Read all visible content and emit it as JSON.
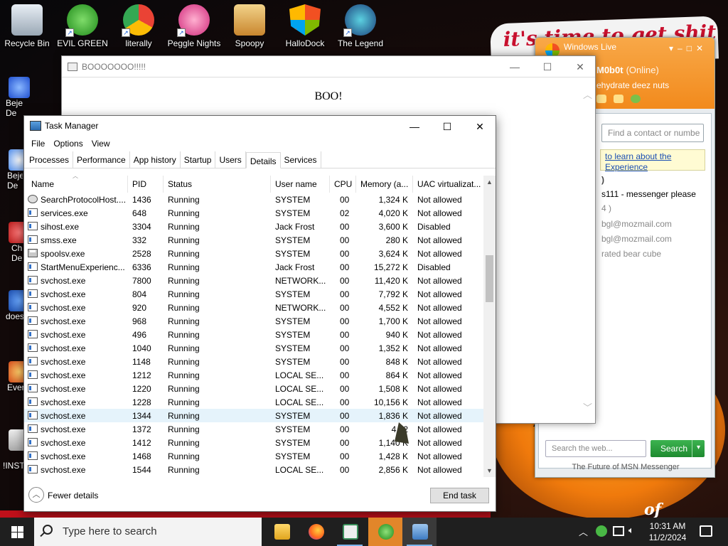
{
  "desktop": {
    "icons": [
      {
        "label": "Recycle Bin"
      },
      {
        "label": "EVIL GREEN MSN GO..."
      },
      {
        "label": "literally"
      },
      {
        "label": "Peggle Nights Del..."
      },
      {
        "label": "Spoopy"
      },
      {
        "label": "HalloDock"
      },
      {
        "label": "The Legend of Tide..."
      }
    ],
    "side_labels": [
      "Beje De",
      "Beje De",
      "Ch De",
      "does",
      "Ever",
      "!INST"
    ],
    "banner_text": "it's time to get shit",
    "wallpaper_text": "of"
  },
  "msn": {
    "title": "Windows Live",
    "user_name": "M0b0t",
    "status": "(Online)",
    "personal_message": "ehydrate deez nuts",
    "find_placeholder": "Find a contact or numbe",
    "ad_line1": "to learn about the",
    "ad_line2": "Experience",
    "contacts": [
      ")",
      "s111 - messenger please",
      "4 )",
      "bgl@mozmail.com",
      "bgl@mozmail.com",
      "rated bear cube"
    ],
    "search_placeholder": "Search the web...",
    "search_button": "Search",
    "footer": "The Future of MSN Messenger"
  },
  "boo_window": {
    "title": "BOOOOOOO!!!!!",
    "body_text": "BOO!"
  },
  "task_manager": {
    "title": "Task Manager",
    "menu": [
      "File",
      "Options",
      "View"
    ],
    "tabs": [
      "Processes",
      "Performance",
      "App history",
      "Startup",
      "Users",
      "Details",
      "Services"
    ],
    "active_tab": "Details",
    "columns": [
      "Name",
      "PID",
      "Status",
      "User name",
      "CPU",
      "Memory (a...",
      "UAC virtualizat..."
    ],
    "rows": [
      {
        "name": "SearchProtocolHost....",
        "pid": "1436",
        "status": "Running",
        "user": "SYSTEM",
        "cpu": "00",
        "mem": "1,324 K",
        "uac": "Not allowed",
        "icon": "gear"
      },
      {
        "name": "services.exe",
        "pid": "648",
        "status": "Running",
        "user": "SYSTEM",
        "cpu": "02",
        "mem": "4,020 K",
        "uac": "Not allowed",
        "icon": "app"
      },
      {
        "name": "sihost.exe",
        "pid": "3304",
        "status": "Running",
        "user": "Jack Frost",
        "cpu": "00",
        "mem": "3,600 K",
        "uac": "Disabled",
        "icon": "app"
      },
      {
        "name": "smss.exe",
        "pid": "332",
        "status": "Running",
        "user": "SYSTEM",
        "cpu": "00",
        "mem": "280 K",
        "uac": "Not allowed",
        "icon": "app"
      },
      {
        "name": "spoolsv.exe",
        "pid": "2528",
        "status": "Running",
        "user": "SYSTEM",
        "cpu": "00",
        "mem": "3,624 K",
        "uac": "Not allowed",
        "icon": "printer"
      },
      {
        "name": "StartMenuExperienc...",
        "pid": "6336",
        "status": "Running",
        "user": "Jack Frost",
        "cpu": "00",
        "mem": "15,272 K",
        "uac": "Disabled",
        "icon": "app"
      },
      {
        "name": "svchost.exe",
        "pid": "7800",
        "status": "Running",
        "user": "NETWORK...",
        "cpu": "00",
        "mem": "11,420 K",
        "uac": "Not allowed",
        "icon": "app"
      },
      {
        "name": "svchost.exe",
        "pid": "804",
        "status": "Running",
        "user": "SYSTEM",
        "cpu": "00",
        "mem": "7,792 K",
        "uac": "Not allowed",
        "icon": "app"
      },
      {
        "name": "svchost.exe",
        "pid": "920",
        "status": "Running",
        "user": "NETWORK...",
        "cpu": "00",
        "mem": "4,552 K",
        "uac": "Not allowed",
        "icon": "app"
      },
      {
        "name": "svchost.exe",
        "pid": "968",
        "status": "Running",
        "user": "SYSTEM",
        "cpu": "00",
        "mem": "1,700 K",
        "uac": "Not allowed",
        "icon": "app"
      },
      {
        "name": "svchost.exe",
        "pid": "496",
        "status": "Running",
        "user": "SYSTEM",
        "cpu": "00",
        "mem": "940 K",
        "uac": "Not allowed",
        "icon": "app"
      },
      {
        "name": "svchost.exe",
        "pid": "1040",
        "status": "Running",
        "user": "SYSTEM",
        "cpu": "00",
        "mem": "1,352 K",
        "uac": "Not allowed",
        "icon": "app"
      },
      {
        "name": "svchost.exe",
        "pid": "1148",
        "status": "Running",
        "user": "SYSTEM",
        "cpu": "00",
        "mem": "848 K",
        "uac": "Not allowed",
        "icon": "app"
      },
      {
        "name": "svchost.exe",
        "pid": "1212",
        "status": "Running",
        "user": "LOCAL SE...",
        "cpu": "00",
        "mem": "864 K",
        "uac": "Not allowed",
        "icon": "app"
      },
      {
        "name": "svchost.exe",
        "pid": "1220",
        "status": "Running",
        "user": "LOCAL SE...",
        "cpu": "00",
        "mem": "1,508 K",
        "uac": "Not allowed",
        "icon": "app"
      },
      {
        "name": "svchost.exe",
        "pid": "1228",
        "status": "Running",
        "user": "LOCAL SE...",
        "cpu": "00",
        "mem": "10,156 K",
        "uac": "Not allowed",
        "icon": "app"
      },
      {
        "name": "svchost.exe",
        "pid": "1344",
        "status": "Running",
        "user": "SYSTEM",
        "cpu": "00",
        "mem": "1,836 K",
        "uac": "Not allowed",
        "icon": "app",
        "selected": true
      },
      {
        "name": "svchost.exe",
        "pid": "1372",
        "status": "Running",
        "user": "SYSTEM",
        "cpu": "00",
        "mem": "4,82",
        "uac": "Not allowed",
        "icon": "app"
      },
      {
        "name": "svchost.exe",
        "pid": "1412",
        "status": "Running",
        "user": "SYSTEM",
        "cpu": "00",
        "mem": "1,140 K",
        "uac": "Not allowed",
        "icon": "app"
      },
      {
        "name": "svchost.exe",
        "pid": "1468",
        "status": "Running",
        "user": "SYSTEM",
        "cpu": "00",
        "mem": "1,428 K",
        "uac": "Not allowed",
        "icon": "app"
      },
      {
        "name": "svchost.exe",
        "pid": "1544",
        "status": "Running",
        "user": "LOCAL SE...",
        "cpu": "00",
        "mem": "2,856 K",
        "uac": "Not allowed",
        "icon": "app"
      }
    ],
    "fewer_details": "Fewer details",
    "end_task": "End task"
  },
  "taskbar": {
    "search_placeholder": "Type here to search",
    "time": "10:31 AM",
    "date": "11/2/2024"
  }
}
